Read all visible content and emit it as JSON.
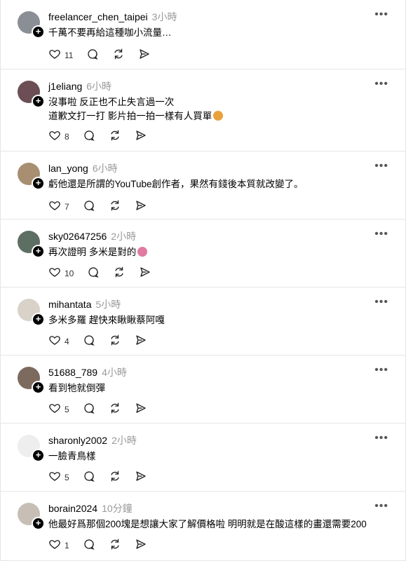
{
  "posts": [
    {
      "user": "freelancer_chen_taipei",
      "time": "3小時",
      "lines": [
        "千萬不要再給這種咖小流量…"
      ],
      "likes": "11",
      "avatar_color": "#8a8e95"
    },
    {
      "user": "j1eliang",
      "time": "6小時",
      "lines": [
        "沒事啦 反正也不止失言過一次",
        "道歉文打一打 影片拍一拍一樣有人買單"
      ],
      "likes": "8",
      "avatar_color": "#6b4f55",
      "emoji_line": 1,
      "emoji_color": "#e9a23b"
    },
    {
      "user": "lan_yong",
      "time": "6小時",
      "lines": [
        "虧他還是所謂的YouTube創作者，果然有錢後本質就改變了。"
      ],
      "likes": "7",
      "avatar_color": "#a88f72"
    },
    {
      "user": "sky02647256",
      "time": "2小時",
      "lines": [
        "再次證明 多米是對的"
      ],
      "likes": "10",
      "avatar_color": "#5d6e63",
      "emoji_line": 0,
      "emoji_color": "#e07aa0"
    },
    {
      "user": "mihantata",
      "time": "5小時",
      "lines": [
        "多米多羅 趕快來瞅瞅蔡阿嘎"
      ],
      "likes": "4",
      "avatar_color": "#d8d2c8"
    },
    {
      "user": "51688_789",
      "time": "4小時",
      "lines": [
        "看到牠就倒彈"
      ],
      "likes": "5",
      "avatar_color": "#7c6a5e"
    },
    {
      "user": "sharonly2002",
      "time": "2小時",
      "lines": [
        "一臉青鳥樣"
      ],
      "likes": "5",
      "avatar_color": "#eeeeee"
    },
    {
      "user": "borain2024",
      "time": "10分鐘",
      "lines": [
        "他最好爲那個200塊是想讓大家了解價格啦 明明就是在酸這樣的畫還需要200"
      ],
      "likes": "1",
      "avatar_color": "#c7bfb5"
    }
  ],
  "icons": {
    "like": "heart-icon",
    "comment": "comment-icon",
    "repost": "repost-icon",
    "share": "share-icon",
    "more": "more-icon",
    "follow": "plus-icon"
  },
  "more_glyph": "•••",
  "follow_glyph": "+"
}
